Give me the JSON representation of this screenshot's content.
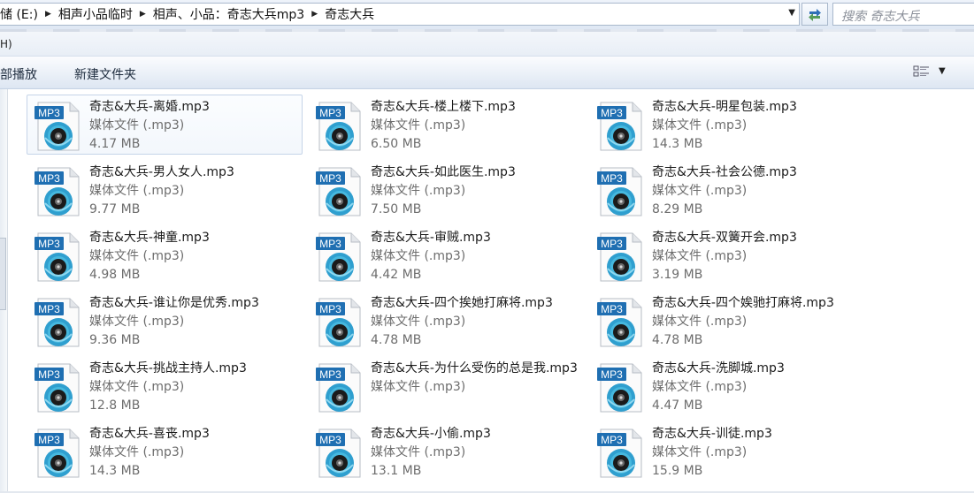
{
  "address_bar": {
    "crumbs": [
      "存储 (E:)",
      "相声小品临时",
      "相声、小品：奇志大兵mp3",
      "奇志大兵"
    ]
  },
  "search": {
    "placeholder": "搜索 奇志大兵"
  },
  "menu": {
    "partial_label": "H)"
  },
  "toolbar": {
    "play_all": "全部播放",
    "new_folder": "新建文件夹"
  },
  "file_type_label": "媒体文件 (.mp3)",
  "icon_badge_text": "MP3",
  "files": [
    {
      "name": "奇志&大兵-离婚.mp3",
      "size": "4.17 MB"
    },
    {
      "name": "奇志&大兵-楼上楼下.mp3",
      "size": "6.50 MB"
    },
    {
      "name": "奇志&大兵-明星包装.mp3",
      "size": "14.3 MB"
    },
    {
      "name": "奇志&大兵-男人女人.mp3",
      "size": "9.77 MB"
    },
    {
      "name": "奇志&大兵-如此医生.mp3",
      "size": "7.50 MB"
    },
    {
      "name": "奇志&大兵-社会公德.mp3",
      "size": "8.29 MB"
    },
    {
      "name": "奇志&大兵-神童.mp3",
      "size": "4.98 MB"
    },
    {
      "name": "奇志&大兵-审贼.mp3",
      "size": "4.42 MB"
    },
    {
      "name": "奇志&大兵-双簧开会.mp3",
      "size": "3.19 MB"
    },
    {
      "name": "奇志&大兵-谁让你是优秀.mp3",
      "size": "9.36 MB"
    },
    {
      "name": "奇志&大兵-四个挨她打麻将.mp3",
      "size": "4.78 MB"
    },
    {
      "name": "奇志&大兵-四个娭驰打麻将.mp3",
      "size": "4.78 MB"
    },
    {
      "name": "奇志&大兵-挑战主持人.mp3",
      "size": "12.8 MB"
    },
    {
      "name": "奇志&大兵-为什么受伤的总是我.mp3",
      "size": ""
    },
    {
      "name": "奇志&大兵-洗脚城.mp3",
      "size": "4.47 MB"
    },
    {
      "name": "奇志&大兵-喜丧.mp3",
      "size": "14.3 MB"
    },
    {
      "name": "奇志&大兵-小偷.mp3",
      "size": "13.1 MB"
    },
    {
      "name": "奇志&大兵-训徒.mp3",
      "size": "15.9 MB"
    }
  ]
}
